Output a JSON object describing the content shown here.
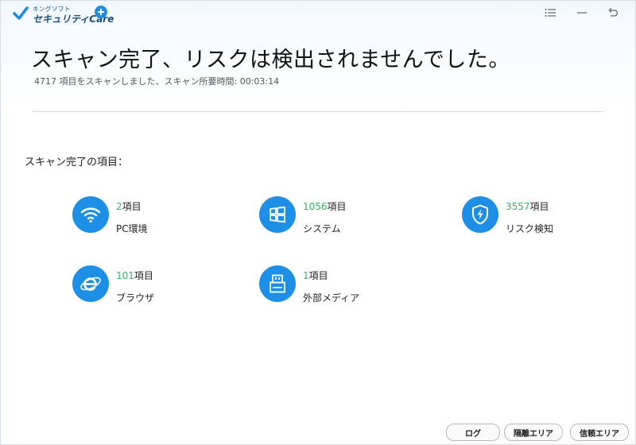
{
  "app": {
    "logo_small": "キングソフト",
    "logo_main": "セキュリティCare"
  },
  "window_controls": {
    "menu_icon": "menu-icon",
    "minimize_icon": "minimize-icon",
    "back_icon": "back-arrow-icon"
  },
  "result": {
    "headline": "スキャン完了、リスクは検出されませんでした。",
    "subline": "4717 項目をスキャンしました、スキャン所要時間: 00:03:14"
  },
  "section_label": "スキャン完了の項目：",
  "items": [
    {
      "count": "2",
      "unit": "項目",
      "name": "PC環境",
      "icon": "wifi-icon"
    },
    {
      "count": "1056",
      "unit": "項目",
      "name": "システム",
      "icon": "windows-icon"
    },
    {
      "count": "3557",
      "unit": "項目",
      "name": "リスク検知",
      "icon": "shield-bolt-icon"
    },
    {
      "count": "101",
      "unit": "項目",
      "name": "ブラウザ",
      "icon": "browser-icon"
    },
    {
      "count": "1",
      "unit": "項目",
      "name": "外部メディア",
      "icon": "usb-drive-icon"
    }
  ],
  "footer": {
    "log_label": "ログ",
    "quarantine_label": "隔離エリア",
    "trusted_label": "信頼エリア"
  },
  "colors": {
    "accent": "#1d8fe6",
    "count_green": "#2fb86a"
  }
}
